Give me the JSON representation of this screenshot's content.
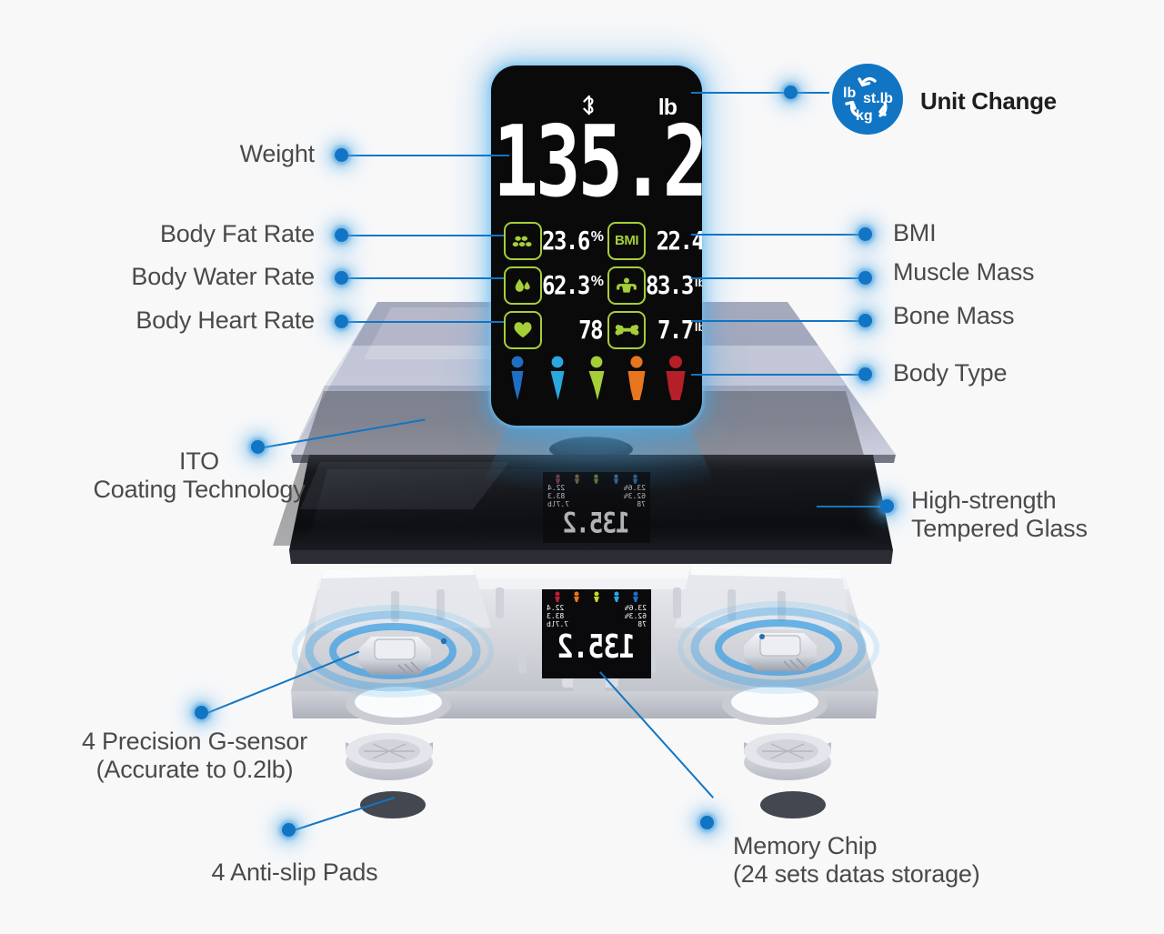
{
  "background_color": "#f8f8f9",
  "accent_color": "#1175c4",
  "lcd": {
    "unit": "lb",
    "bluetooth_icon": "bluetooth-icon",
    "weight": "135.2",
    "metrics": [
      {
        "key": "body_fat_rate",
        "icon": "body-fat-icon",
        "value": "23.6",
        "suffix": "%"
      },
      {
        "key": "bmi",
        "icon": "bmi-icon",
        "value": "22.4",
        "suffix": ""
      },
      {
        "key": "body_water_rate",
        "icon": "water-drop-icon",
        "value": "62.3",
        "suffix": "%"
      },
      {
        "key": "muscle_mass",
        "icon": "muscle-icon",
        "value": "83.3",
        "suffix": "lb"
      },
      {
        "key": "body_heart_rate",
        "icon": "heart-icon",
        "value": "78",
        "suffix": ""
      },
      {
        "key": "bone_mass",
        "icon": "bone-icon",
        "value": "7.7",
        "suffix": "lb"
      }
    ],
    "body_types": [
      {
        "name": "body-type-1",
        "color": "#1f6fc4"
      },
      {
        "name": "body-type-2",
        "color": "#29a8e0"
      },
      {
        "name": "body-type-3",
        "color": "#a6ce39"
      },
      {
        "name": "body-type-4",
        "color": "#e8761e"
      },
      {
        "name": "body-type-5",
        "color": "#b51f28"
      }
    ]
  },
  "mini_display": {
    "weight": "135.2",
    "unit": "lb",
    "rows": [
      [
        "23.6%",
        "22.4"
      ],
      [
        "62.3%",
        "83.3"
      ],
      [
        "78",
        "7.7lb"
      ]
    ]
  },
  "callouts": {
    "weight": "Weight",
    "body_fat_rate": "Body Fat Rate",
    "body_water_rate": "Body Water Rate",
    "body_heart_rate": "Body Heart Rate",
    "ito": "ITO\nCoating Technology",
    "g_sensor": "4 Precision G-sensor\n(Accurate to 0.2lb)",
    "anti_slip": "4 Anti-slip Pads",
    "bmi": "BMI",
    "muscle_mass": "Muscle Mass",
    "bone_mass": "Bone Mass",
    "body_type": "Body Type",
    "tempered_glass": "High-strength\nTempered Glass",
    "memory_chip": "Memory Chip\n(24 sets datas storage)"
  },
  "unit_change": {
    "title": "Unit Change",
    "units": [
      "lb",
      "st.lb",
      "kg"
    ],
    "badge_color": "#1175c4"
  }
}
